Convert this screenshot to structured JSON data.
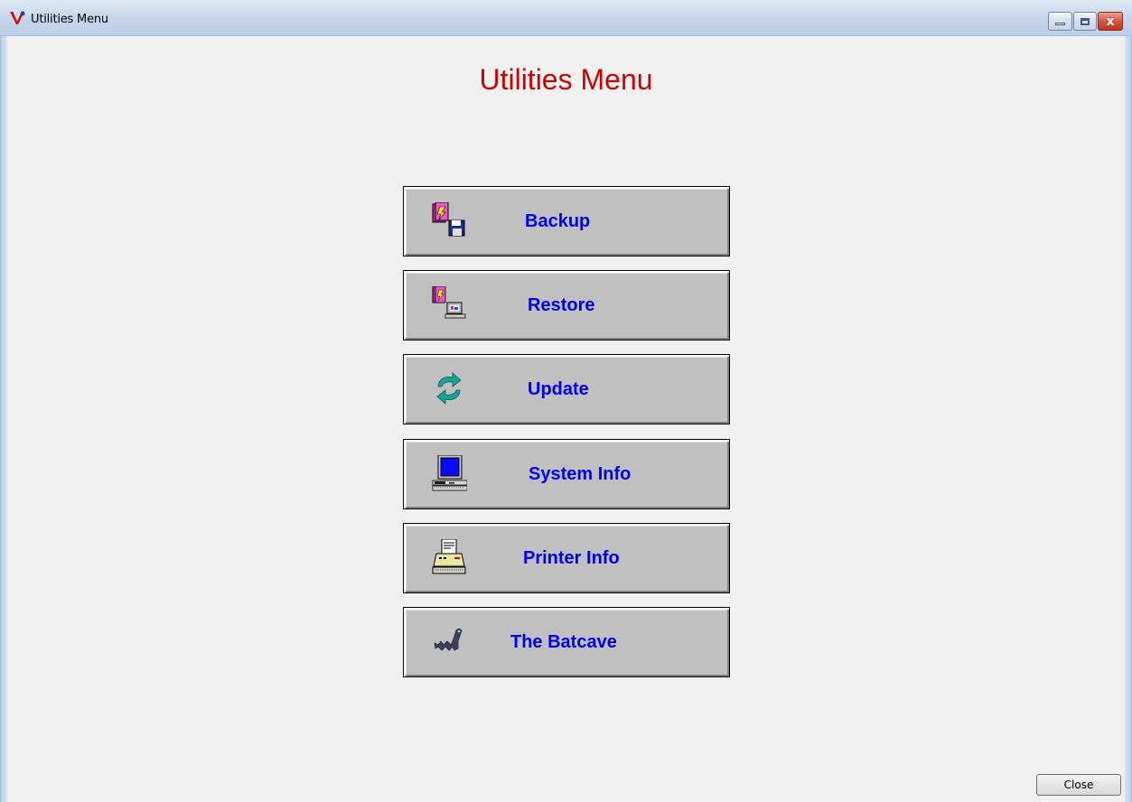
{
  "window": {
    "title": "Utilities Menu",
    "icon": "red-blue-app-icon",
    "controls": {
      "minimize": "minimize-icon",
      "maximize": "maximize-icon",
      "close": "x"
    }
  },
  "page": {
    "heading": "Utilities Menu",
    "heading_color": "#cc0000",
    "label_color": "#0000ee"
  },
  "menu": {
    "buttons": [
      {
        "label": "Backup",
        "icon": "backup-disk-icon"
      },
      {
        "label": "Restore",
        "icon": "restore-computer-icon"
      },
      {
        "label": "Update",
        "icon": "update-arrows-icon"
      },
      {
        "label": "System Info",
        "icon": "computer-monitor-icon"
      },
      {
        "label": "Printer Info",
        "icon": "printer-icon"
      },
      {
        "label": "The Batcave",
        "icon": "bat-icon"
      }
    ]
  },
  "footer": {
    "close_label": "Close"
  }
}
